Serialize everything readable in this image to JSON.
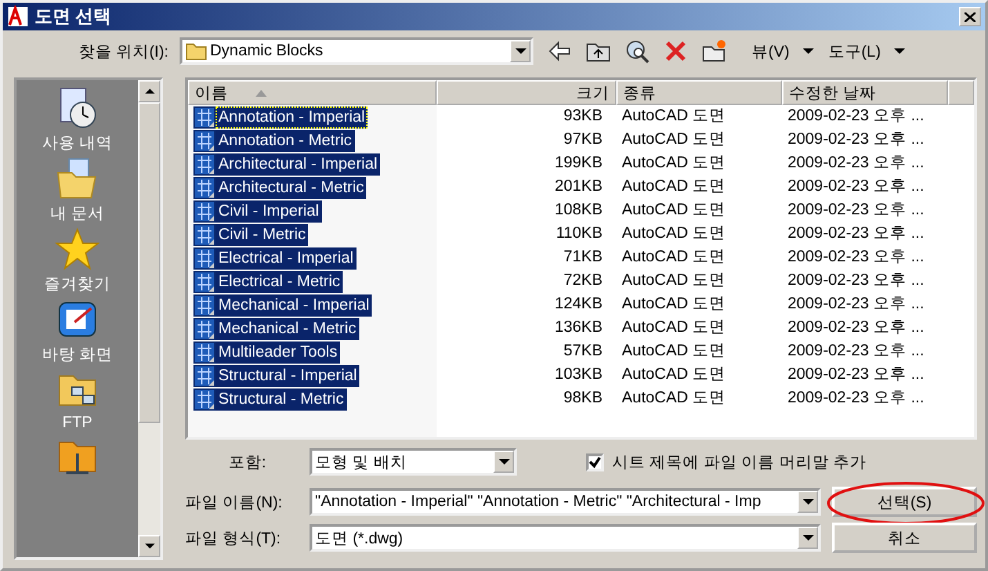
{
  "window": {
    "title": "도면 선택"
  },
  "toolbar": {
    "look_in_label": "찾을 위치(I):",
    "look_in_value": "Dynamic Blocks",
    "view_menu": "뷰(V)",
    "tools_menu": "도구(L)"
  },
  "places": [
    {
      "label": "사용 내역",
      "kind": "history"
    },
    {
      "label": "내 문서",
      "kind": "documents"
    },
    {
      "label": "즐겨찾기",
      "kind": "favorites"
    },
    {
      "label": "바탕 화면",
      "kind": "desktop"
    },
    {
      "label": "FTP",
      "kind": "ftp"
    },
    {
      "kind": "folder"
    }
  ],
  "file_list": {
    "columns": [
      "이름",
      "크기",
      "종류",
      "수정한 날짜"
    ],
    "rows": [
      {
        "name": "Annotation - Imperial",
        "size": "93KB",
        "type": "AutoCAD 도면",
        "modified": "2009-02-23 오후 ...",
        "selected": true,
        "focused": true
      },
      {
        "name": "Annotation - Metric",
        "size": "97KB",
        "type": "AutoCAD 도면",
        "modified": "2009-02-23 오후 ...",
        "selected": true,
        "focused": false
      },
      {
        "name": "Architectural - Imperial",
        "size": "199KB",
        "type": "AutoCAD 도면",
        "modified": "2009-02-23 오후 ...",
        "selected": true,
        "focused": false
      },
      {
        "name": "Architectural - Metric",
        "size": "201KB",
        "type": "AutoCAD 도면",
        "modified": "2009-02-23 오후 ...",
        "selected": true,
        "focused": false
      },
      {
        "name": "Civil - Imperial",
        "size": "108KB",
        "type": "AutoCAD 도면",
        "modified": "2009-02-23 오후 ...",
        "selected": true,
        "focused": false
      },
      {
        "name": "Civil - Metric",
        "size": "110KB",
        "type": "AutoCAD 도면",
        "modified": "2009-02-23 오후 ...",
        "selected": true,
        "focused": false
      },
      {
        "name": "Electrical - Imperial",
        "size": "71KB",
        "type": "AutoCAD 도면",
        "modified": "2009-02-23 오후 ...",
        "selected": true,
        "focused": false
      },
      {
        "name": "Electrical - Metric",
        "size": "72KB",
        "type": "AutoCAD 도면",
        "modified": "2009-02-23 오후 ...",
        "selected": true,
        "focused": false
      },
      {
        "name": "Mechanical - Imperial",
        "size": "124KB",
        "type": "AutoCAD 도면",
        "modified": "2009-02-23 오후 ...",
        "selected": true,
        "focused": false
      },
      {
        "name": "Mechanical - Metric",
        "size": "136KB",
        "type": "AutoCAD 도면",
        "modified": "2009-02-23 오후 ...",
        "selected": true,
        "focused": false
      },
      {
        "name": "Multileader Tools",
        "size": "57KB",
        "type": "AutoCAD 도면",
        "modified": "2009-02-23 오후 ...",
        "selected": true,
        "focused": false
      },
      {
        "name": "Structural - Imperial",
        "size": "103KB",
        "type": "AutoCAD 도면",
        "modified": "2009-02-23 오후 ...",
        "selected": true,
        "focused": false
      },
      {
        "name": "Structural - Metric",
        "size": "98KB",
        "type": "AutoCAD 도면",
        "modified": "2009-02-23 오후 ...",
        "selected": true,
        "focused": false
      }
    ]
  },
  "include": {
    "label": "포함:",
    "value": "모형 및 배치"
  },
  "prefix_option": {
    "label": "시트 제목에 파일 이름 머리말 추가",
    "checked": true
  },
  "file_name": {
    "label": "파일 이름(N):",
    "value": "\"Annotation - Imperial\" \"Annotation - Metric\" \"Architectural - Imp"
  },
  "file_type": {
    "label": "파일 형식(T):",
    "value": "도면 (*.dwg)"
  },
  "buttons": [
    {
      "label": "선택(S)",
      "highlighted": true
    },
    {
      "label": "취소",
      "highlighted": false
    }
  ]
}
